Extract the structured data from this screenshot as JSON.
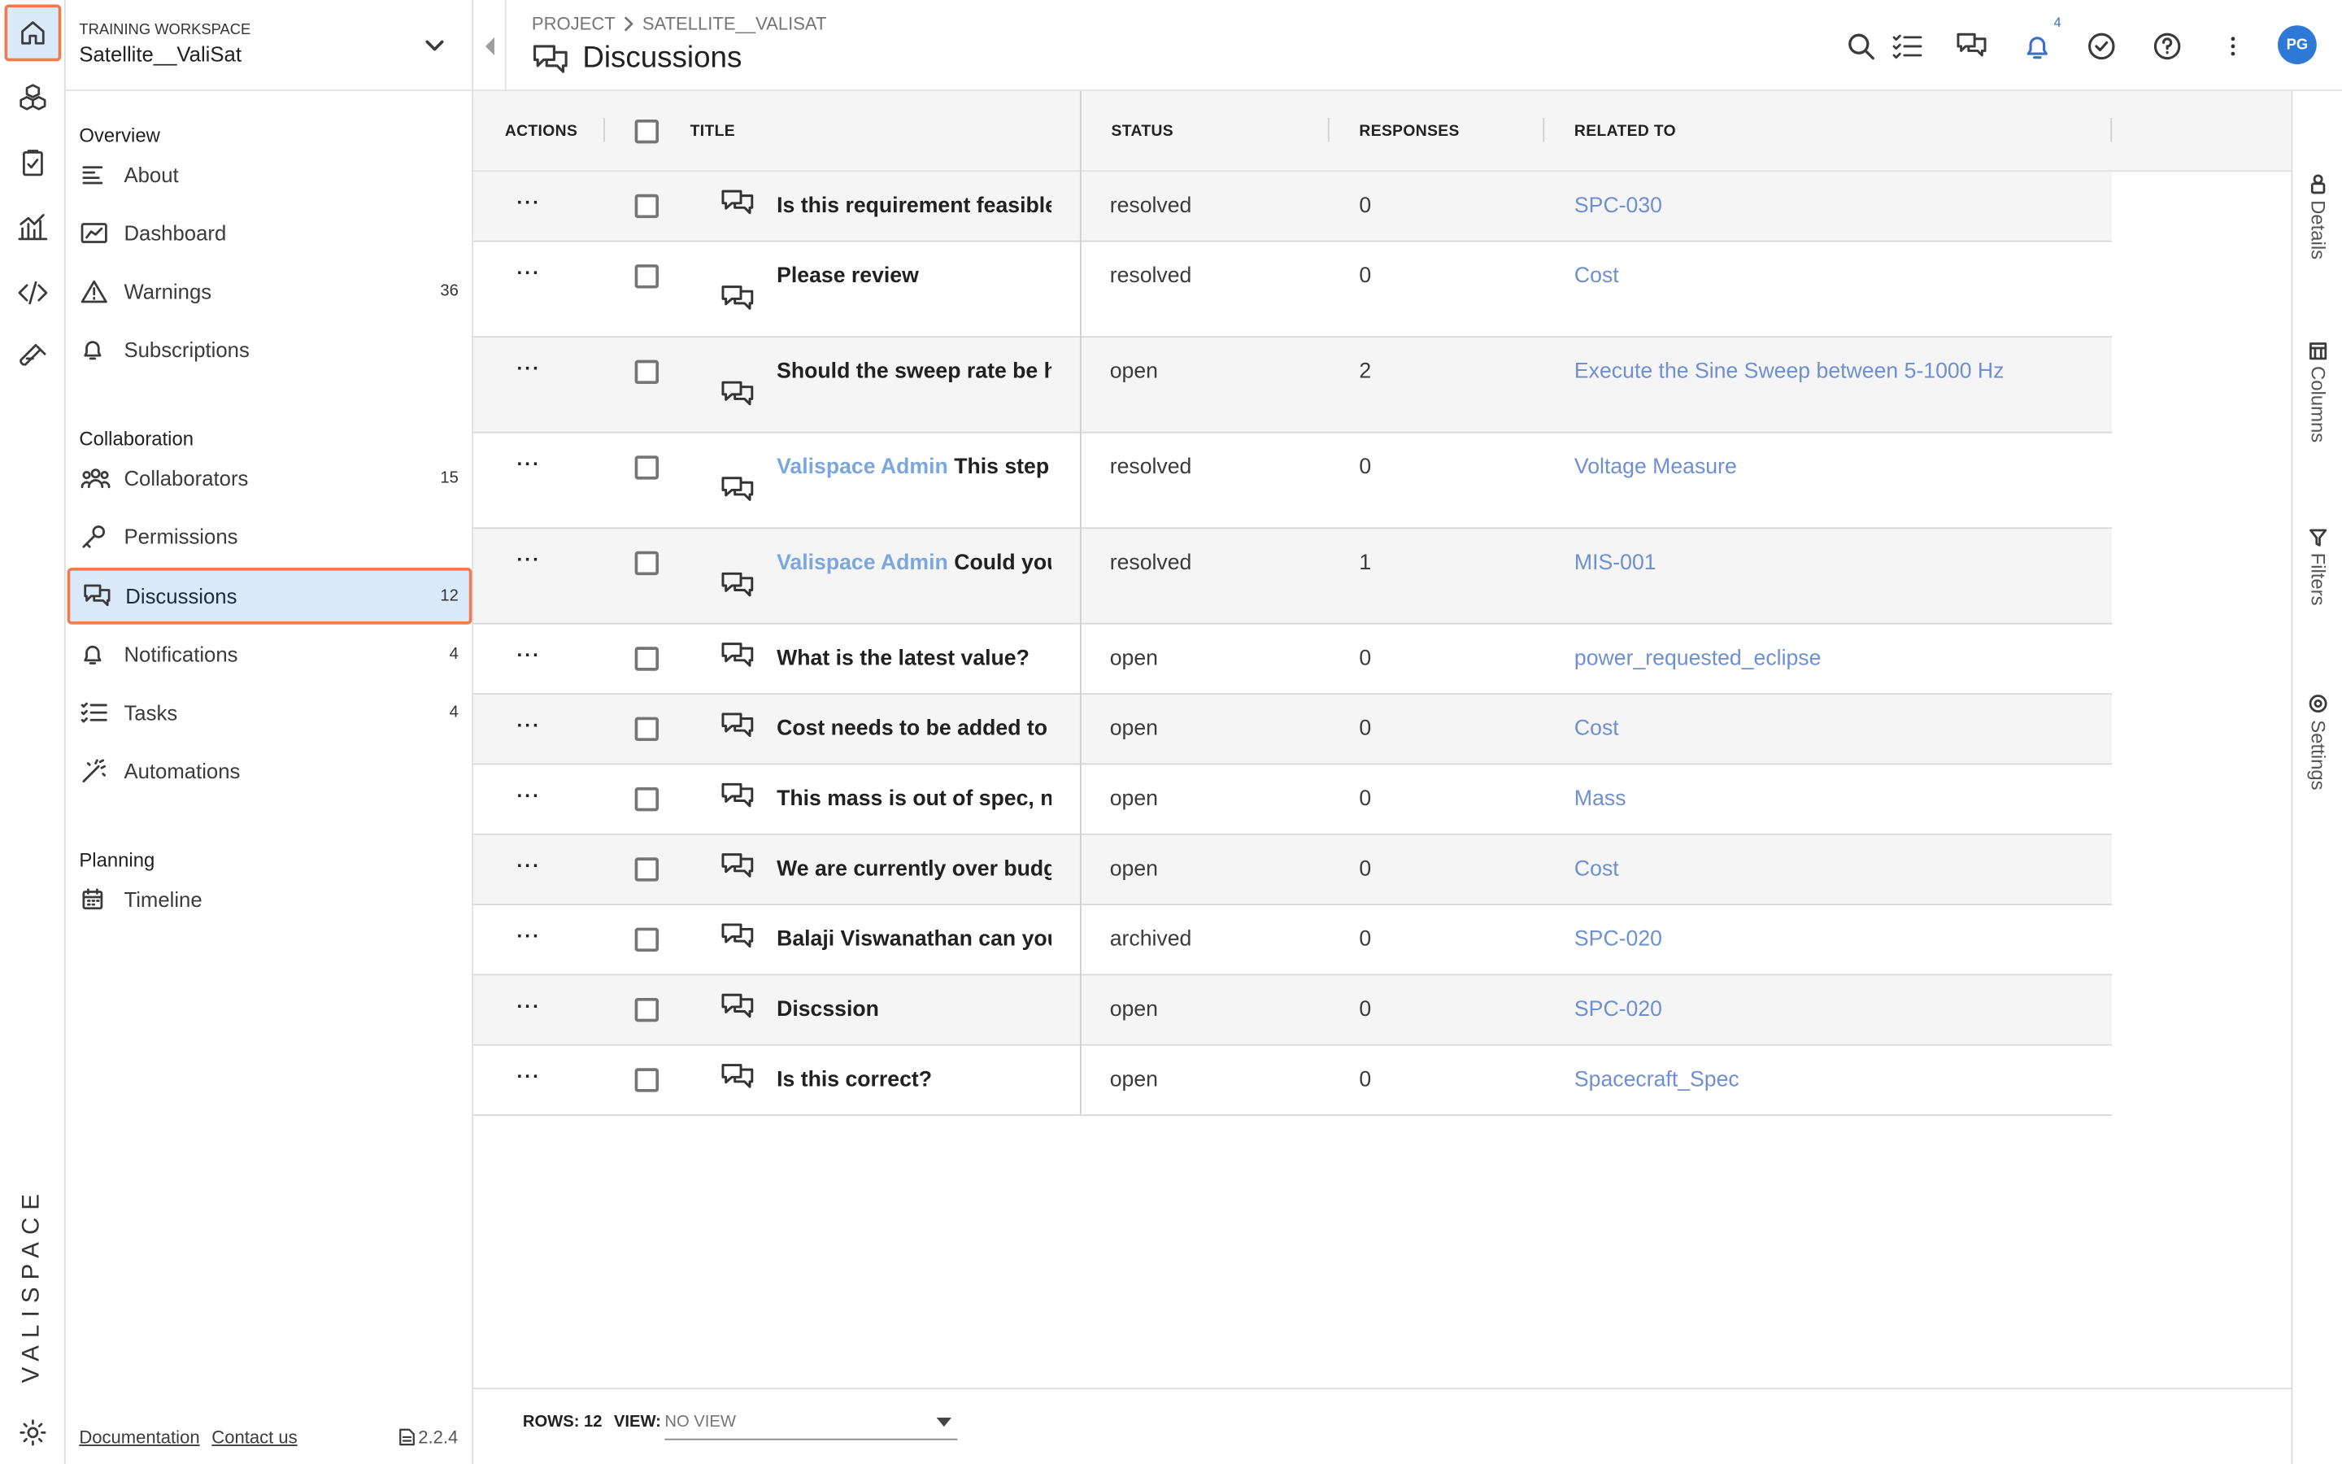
{
  "brand": {
    "name": "VALISPACE"
  },
  "rail": {
    "items": [
      "home-icon",
      "components-icon",
      "requirements-icon",
      "analytics-icon",
      "scripting-icon",
      "tests-icon"
    ],
    "settings_icon": "gear-icon"
  },
  "workspace": {
    "label": "TRAINING WORKSPACE",
    "name": "Satellite__ValiSat"
  },
  "sidebar": {
    "sections": [
      {
        "title": "Overview",
        "items": [
          {
            "label": "About",
            "icon": "lines-icon",
            "count": ""
          },
          {
            "label": "Dashboard",
            "icon": "dashboard-icon",
            "count": ""
          },
          {
            "label": "Warnings",
            "icon": "warning-icon",
            "count": "36"
          },
          {
            "label": "Subscriptions",
            "icon": "bell-icon",
            "count": ""
          }
        ]
      },
      {
        "title": "Collaboration",
        "items": [
          {
            "label": "Collaborators",
            "icon": "people-icon",
            "count": "15"
          },
          {
            "label": "Permissions",
            "icon": "key-icon",
            "count": ""
          },
          {
            "label": "Discussions",
            "icon": "chat-icon",
            "count": "12",
            "active": true
          },
          {
            "label": "Notifications",
            "icon": "bell-icon",
            "count": "4"
          },
          {
            "label": "Tasks",
            "icon": "tasks-icon",
            "count": "4"
          },
          {
            "label": "Automations",
            "icon": "wand-icon",
            "count": ""
          }
        ]
      },
      {
        "title": "Planning",
        "items": [
          {
            "label": "Timeline",
            "icon": "calendar-icon",
            "count": ""
          }
        ]
      }
    ],
    "footer": {
      "documentation": "Documentation",
      "contact": "Contact us",
      "version": "2.2.4"
    }
  },
  "header": {
    "breadcrumb": [
      "PROJECT",
      "SATELLITE__VALISAT"
    ],
    "title": "Discussions",
    "notification_badge": "4"
  },
  "user": {
    "initials": "PG",
    "avatar_color": "#2e78d6"
  },
  "accent": {
    "highlight_border": "#ee7d4e",
    "active_bg": "#dbeafb",
    "link": "#6e8fd0"
  },
  "table": {
    "columns": {
      "actions": "ACTIONS",
      "title": "TITLE",
      "status": "STATUS",
      "responses": "RESPONSES",
      "related": "RELATED TO"
    },
    "rows": [
      {
        "author": "",
        "title": "Is this requirement feasible?",
        "status": "resolved",
        "responses": "0",
        "related": "SPC-030"
      },
      {
        "author": "",
        "title": "Please review",
        "status": "resolved",
        "responses": "0",
        "related": "Cost"
      },
      {
        "author": "",
        "title": "Should the sweep rate be h",
        "status": "open",
        "responses": "2",
        "related": "Execute the Sine Sweep between 5-1000 Hz"
      },
      {
        "author": "Valispace Admin",
        "title": "This step",
        "status": "resolved",
        "responses": "0",
        "related": "Voltage Measure"
      },
      {
        "author": "Valispace Admin",
        "title": "Could you",
        "status": "resolved",
        "responses": "1",
        "related": "MIS-001"
      },
      {
        "author": "",
        "title": "What is the latest value?",
        "status": "open",
        "responses": "0",
        "related": "power_requested_eclipse"
      },
      {
        "author": "",
        "title": "Cost needs to be added to",
        "status": "open",
        "responses": "0",
        "related": "Cost"
      },
      {
        "author": "",
        "title": "This mass is out of spec, n",
        "status": "open",
        "responses": "0",
        "related": "Mass"
      },
      {
        "author": "",
        "title": "We are currently over budg",
        "status": "open",
        "responses": "0",
        "related": "Cost"
      },
      {
        "author": "",
        "title": "Balaji Viswanathan can you",
        "status": "archived",
        "responses": "0",
        "related": "SPC-020"
      },
      {
        "author": "",
        "title": "Discssion",
        "status": "open",
        "responses": "0",
        "related": "SPC-020"
      },
      {
        "author": "",
        "title": "Is this correct?",
        "status": "open",
        "responses": "0",
        "related": "Spacecraft_Spec"
      }
    ]
  },
  "right_panel": {
    "tabs": [
      "Details",
      "Columns",
      "Filters",
      "Settings"
    ]
  },
  "statusbar": {
    "rows_label": "ROWS: 12",
    "view_label": "VIEW:",
    "view_value": "NO VIEW"
  }
}
